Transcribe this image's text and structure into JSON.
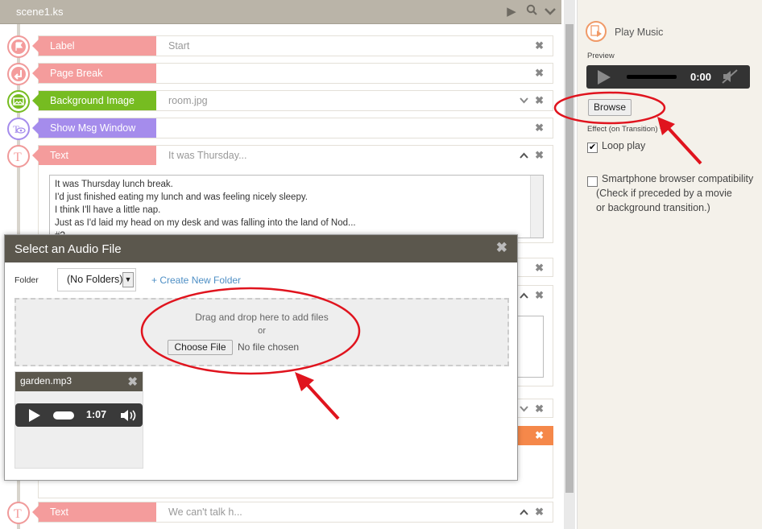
{
  "file_tab": {
    "title": "scene1.ks"
  },
  "timeline": [
    {
      "label": "Label",
      "value": "Start",
      "color": "#f49c9c",
      "icon": "flag-icon"
    },
    {
      "label": "Page Break",
      "value": "",
      "color": "#f49c9c",
      "icon": "page-break-icon"
    },
    {
      "label": "Background Image",
      "value": "room.jpg",
      "color": "#76bc21",
      "icon": "image-icon"
    },
    {
      "label": "Show Msg Window",
      "value": "",
      "color": "#a58cec",
      "icon": "text-eye-icon"
    },
    {
      "label": "Text",
      "value": "It was Thursday...",
      "color": "#f49c9c",
      "icon": "text-t-icon"
    },
    {
      "label": "Text",
      "value": "We can't talk h...",
      "color": "#f49c9c",
      "icon": "text-t-icon"
    }
  ],
  "text_editor": {
    "lines": [
      "It was Thursday lunch break.",
      "I'd just finished eating my lunch and was feeling nicely sleepy.",
      "I think I'll have a little nap.",
      "Just as I'd laid my head on my desk and was falling into the land of Nod...",
      "#?"
    ]
  },
  "right_panel": {
    "title": "Play Music",
    "preview_label": "Preview",
    "preview_time": "0:00",
    "browse_label": "Browse",
    "effect_label": "Effect (on Transition) %",
    "loop_label": "Loop play",
    "loop_checked": true,
    "compat_label": "Smartphone browser compatibility",
    "compat_note_1": "(Check if preceded by a movie",
    "compat_note_2": "or background transition.)",
    "accent": "#f09a68"
  },
  "modal": {
    "title": "Select an Audio File",
    "folder_label": "Folder",
    "folder_value": "(No Folders)",
    "create_folder": "+ Create New Folder",
    "drop_line1": "Drag and drop here to add files",
    "drop_line2": "or",
    "choose_label": "Choose File",
    "no_file": "No file chosen",
    "files": [
      {
        "name": "garden.mp3",
        "duration": "1:07"
      }
    ]
  }
}
